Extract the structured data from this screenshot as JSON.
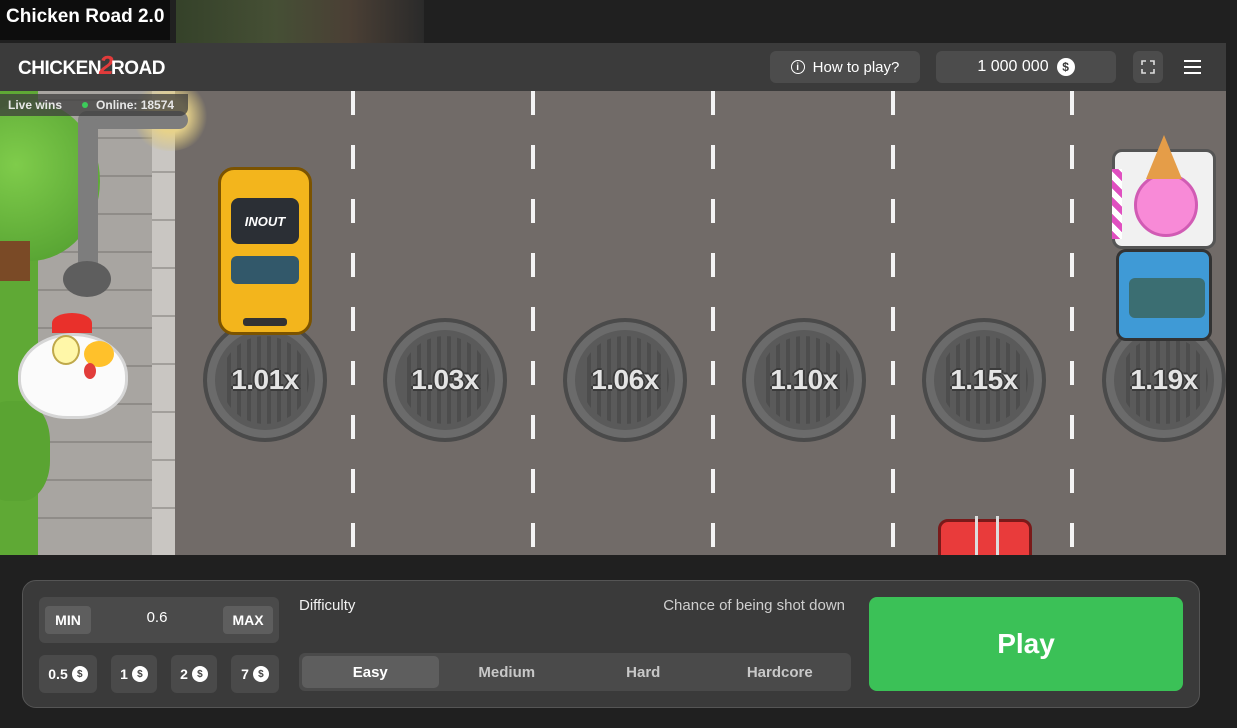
{
  "window": {
    "title": "Chicken Road 2.0"
  },
  "header": {
    "logo_left": "CHICKEN",
    "logo_mid": "2",
    "logo_right": "ROAD",
    "how_to_play": "How to play?",
    "balance": "1 000 000",
    "currency_icon": "$"
  },
  "live": {
    "label": "Live wins",
    "online": "Online: 18574"
  },
  "multipliers": [
    "1.01x",
    "1.03x",
    "1.06x",
    "1.10x",
    "1.15x",
    "1.19x"
  ],
  "taxi_sign": "INOUT",
  "controls": {
    "min_label": "MIN",
    "max_label": "MAX",
    "bet_value": "0.6",
    "chips": [
      "0.5",
      "1",
      "2",
      "7"
    ],
    "difficulty_label": "Difficulty",
    "chance_label": "Chance of being shot down",
    "difficulty_options": [
      "Easy",
      "Medium",
      "Hard",
      "Hardcore"
    ],
    "selected_difficulty": "Easy",
    "play_label": "Play"
  },
  "colors": {
    "accent_play": "#3bc157",
    "road": "#716b68",
    "header": "#3b3b3b",
    "online_dot": "#3ccb5a"
  }
}
